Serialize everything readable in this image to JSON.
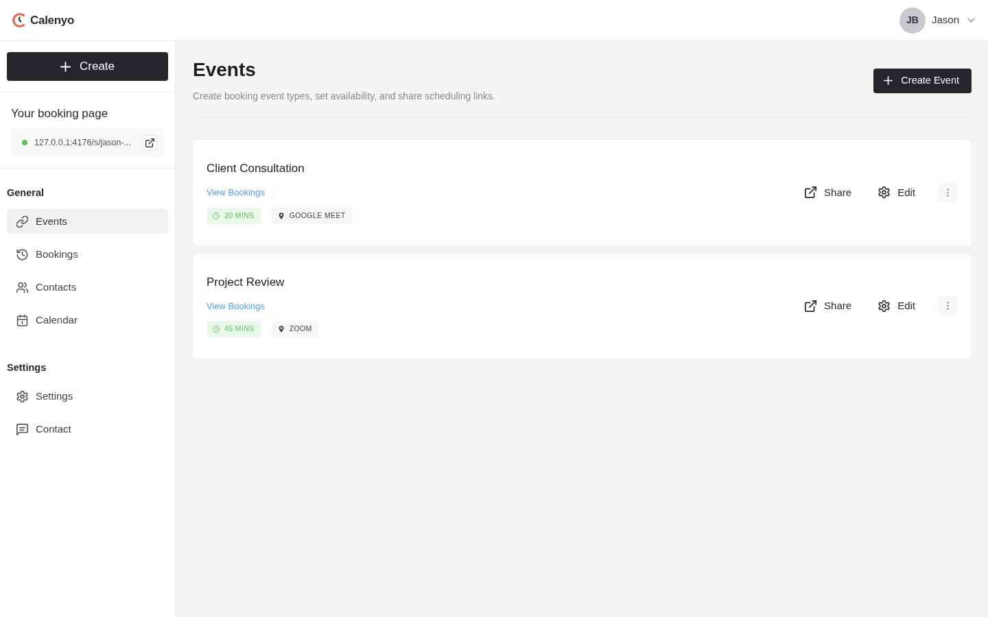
{
  "header": {
    "brand": "Calenyo",
    "user": {
      "initials": "JB",
      "name": "Jason"
    }
  },
  "sidebar": {
    "create_button": "Create",
    "booking_page": {
      "title": "Your booking page",
      "url": "127.0.0.1:4176/s/jason-..."
    },
    "sections": [
      {
        "heading": "General",
        "items": [
          {
            "label": "Events",
            "kind": "link",
            "selected": true
          },
          {
            "label": "Bookings",
            "kind": "history",
            "selected": false
          },
          {
            "label": "Contacts",
            "kind": "people",
            "selected": false
          },
          {
            "label": "Calendar",
            "kind": "calendar",
            "selected": false
          }
        ]
      },
      {
        "heading": "Settings",
        "items": [
          {
            "label": "Settings",
            "kind": "gear",
            "selected": false
          },
          {
            "label": "Contact",
            "kind": "chat",
            "selected": false
          }
        ]
      }
    ]
  },
  "main": {
    "title": "Events",
    "subtitle": "Create booking event types, set availability, and share scheduling links.",
    "create_button": "Create Event",
    "events": [
      {
        "title": "Client Consultation",
        "link": "View Bookings",
        "duration": "30 MINS",
        "location": "GOOGLE MEET",
        "actions": [
          {
            "label": "Share",
            "kind": "share"
          },
          {
            "label": "Edit",
            "kind": "edit"
          }
        ]
      },
      {
        "title": "Project Review",
        "link": "View Bookings",
        "duration": "45 MINS",
        "location": "ZOOM",
        "actions": [
          {
            "label": "Share",
            "kind": "share"
          },
          {
            "label": "Edit",
            "kind": "edit"
          }
        ]
      }
    ]
  }
}
